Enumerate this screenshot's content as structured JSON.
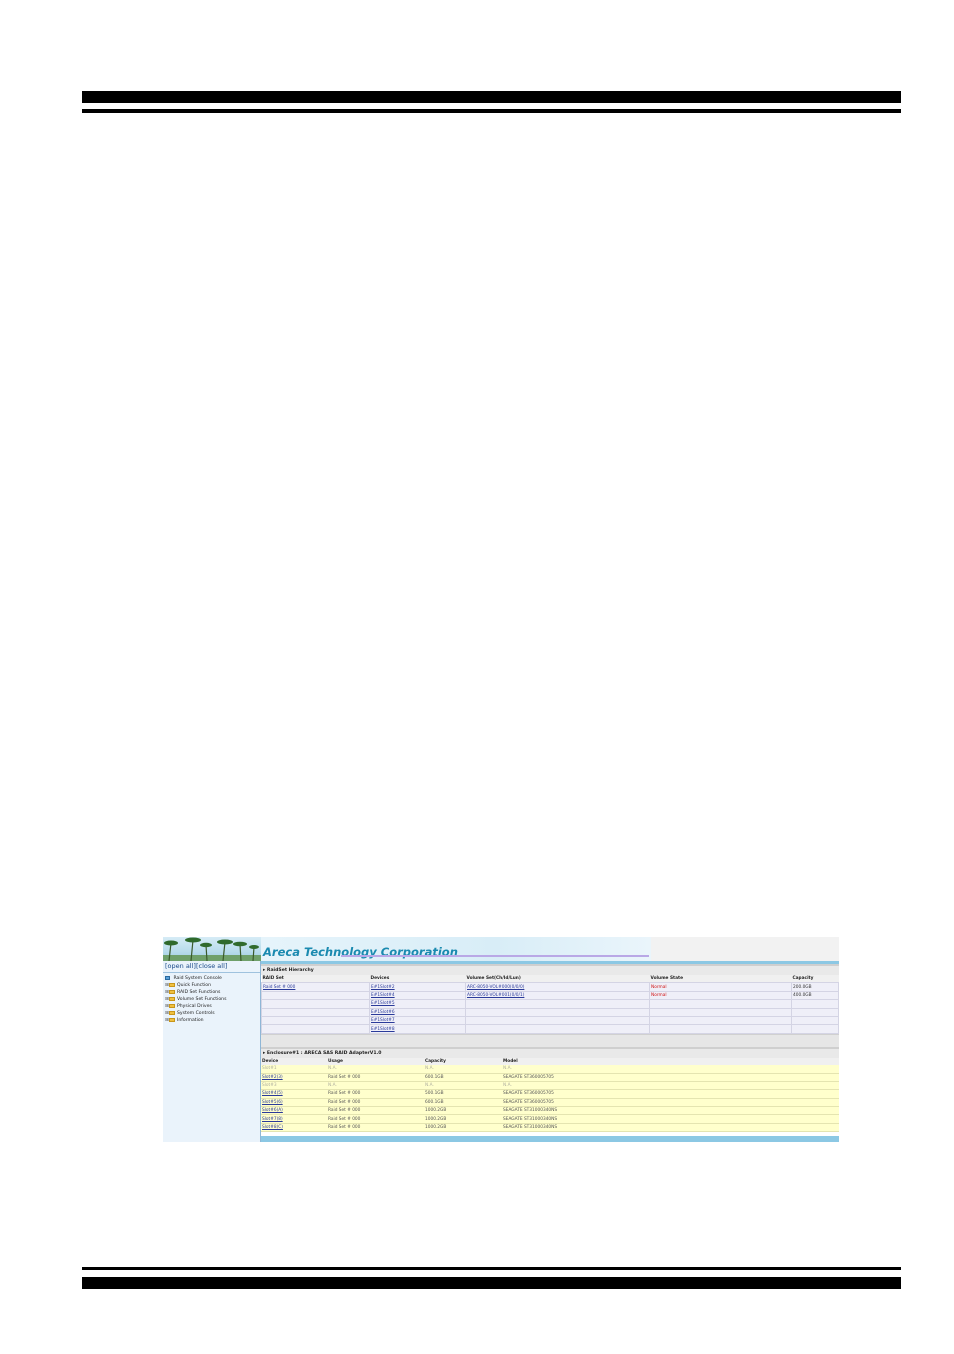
{
  "app": {
    "company_title": "Areca Technology Corporation"
  },
  "sidebar": {
    "open_close": "[open all][close all]",
    "root": "Raid System Console",
    "items": [
      {
        "label": "Quick Function"
      },
      {
        "label": "RAID Set Functions"
      },
      {
        "label": "Volume Set Functions"
      },
      {
        "label": "Physical Drives"
      },
      {
        "label": "System Controls"
      },
      {
        "label": "Information"
      }
    ]
  },
  "raidset_hierarchy": {
    "title": "RaidSet Hierarchy",
    "headers": [
      "RAID Set",
      "Devices",
      "Volume Set(Ch/Id/Lun)",
      "Volume State",
      "Capacity"
    ],
    "rows": [
      {
        "raid_set": "Raid Set # 000",
        "device": "E#1Slot#2",
        "volume": "ARC-8050-VOL#000(0/0/0)",
        "state": "Normal",
        "capacity": "200.0GB"
      },
      {
        "raid_set": "",
        "device": "E#1Slot#4",
        "volume": "ARC-8050-VOL#001(0/0/1)",
        "state": "Normal",
        "capacity": "400.0GB"
      },
      {
        "raid_set": "",
        "device": "E#1Slot#5",
        "volume": "",
        "state": "",
        "capacity": ""
      },
      {
        "raid_set": "",
        "device": "E#1Slot#6",
        "volume": "",
        "state": "",
        "capacity": ""
      },
      {
        "raid_set": "",
        "device": "E#1Slot#7",
        "volume": "",
        "state": "",
        "capacity": ""
      },
      {
        "raid_set": "",
        "device": "E#1Slot#8",
        "volume": "",
        "state": "",
        "capacity": ""
      }
    ]
  },
  "enclosure": {
    "title": "Enclosure#1 : ARECA SAS RAID AdapterV1.0",
    "headers": [
      "Device",
      "Usage",
      "Capacity",
      "Model"
    ],
    "rows": [
      {
        "device": "Slot#1",
        "usage": "N.A.",
        "capacity": "N.A.",
        "model": "N.A.",
        "empty": true
      },
      {
        "device": "Slot#2(3)",
        "usage": "Raid Set # 000",
        "capacity": "600.1GB",
        "model": "SEAGATE ST360005705",
        "empty": false
      },
      {
        "device": "Slot#3",
        "usage": "N.A.",
        "capacity": "N.A.",
        "model": "N.A.",
        "empty": true
      },
      {
        "device": "Slot#4(5)",
        "usage": "Raid Set # 000",
        "capacity": "500.1GB",
        "model": "SEAGATE ST360005705",
        "empty": false
      },
      {
        "device": "Slot#5(6)",
        "usage": "Raid Set # 000",
        "capacity": "600.1GB",
        "model": "SEAGATE ST360005705",
        "empty": false
      },
      {
        "device": "Slot#6(A)",
        "usage": "Raid Set # 000",
        "capacity": "1000.2GB",
        "model": "SEAGATE ST31000340NS",
        "empty": false
      },
      {
        "device": "Slot#7(8)",
        "usage": "Raid Set # 000",
        "capacity": "1000.2GB",
        "model": "SEAGATE ST31000340NS",
        "empty": false
      },
      {
        "device": "Slot#8(C)",
        "usage": "Raid Set # 000",
        "capacity": "1000.2GB",
        "model": "SEAGATE ST31000340NS",
        "empty": false
      }
    ]
  },
  "colors": {
    "accent_blue": "#8cc8e4",
    "logo_text": "#1a8ab0",
    "state_normal": "#d01010",
    "device_row_bg": "#ffffcc"
  }
}
